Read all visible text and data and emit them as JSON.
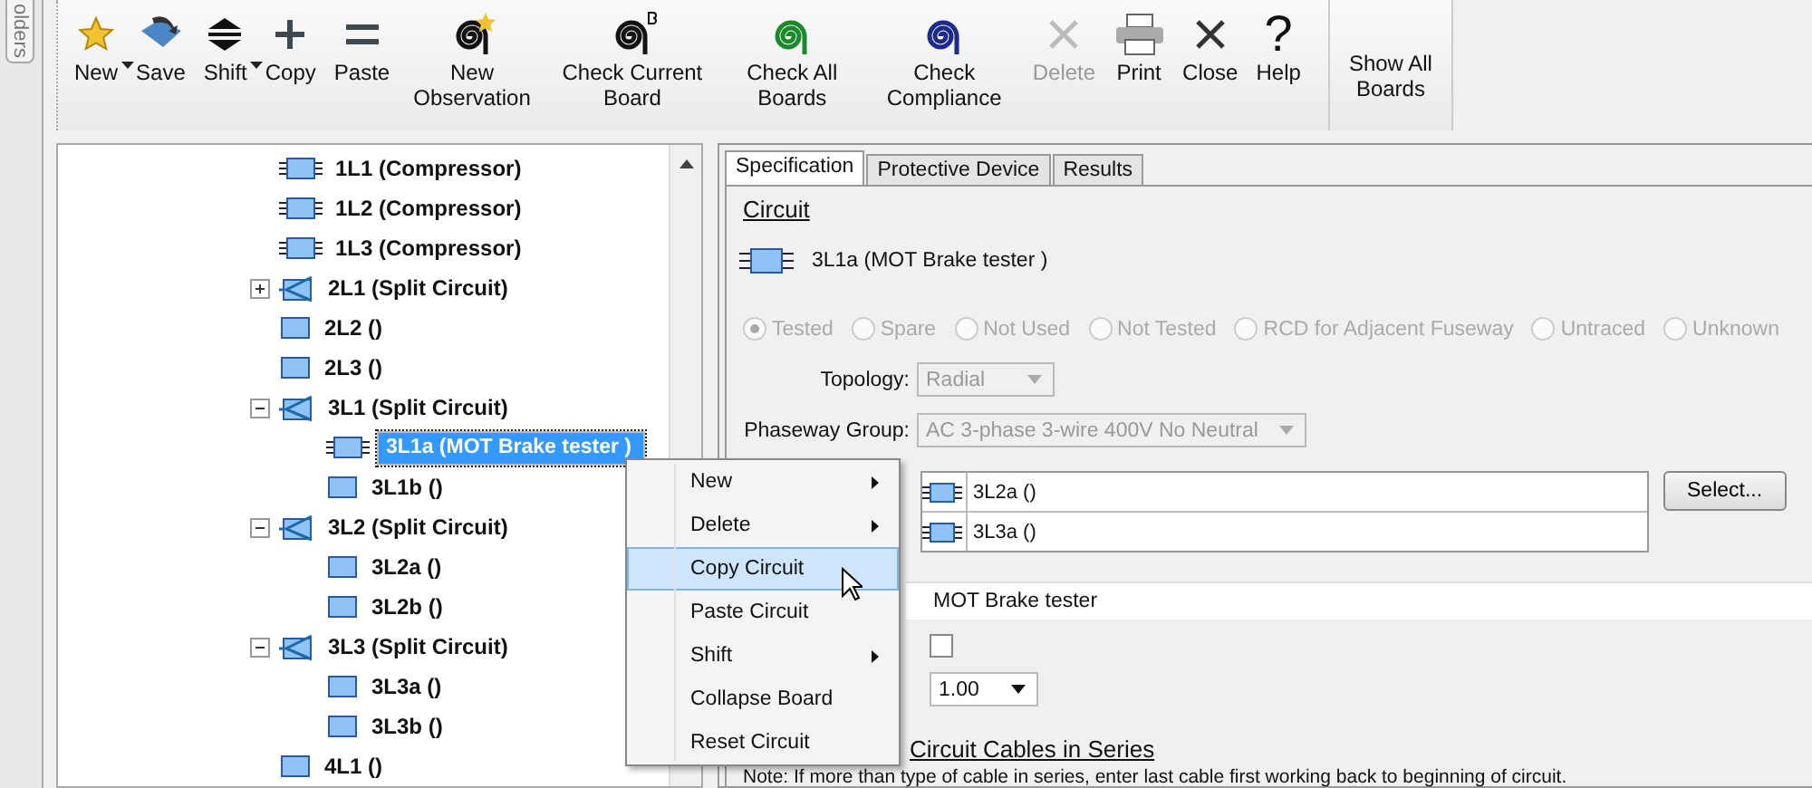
{
  "side_tab": {
    "label": "olders"
  },
  "toolbar": {
    "buttons": [
      {
        "label": "New",
        "kind": "star",
        "dropdown": true,
        "disabled": false
      },
      {
        "label": "Save",
        "kind": "save",
        "dropdown": false,
        "disabled": false
      },
      {
        "label": "Shift",
        "kind": "shift",
        "dropdown": true,
        "disabled": false
      },
      {
        "label": "Copy",
        "kind": "plus",
        "dropdown": false,
        "disabled": false
      },
      {
        "label": "Paste",
        "kind": "equals",
        "dropdown": false,
        "disabled": false
      },
      {
        "label": "New Observation",
        "kind": "spiral-star",
        "dropdown": false,
        "disabled": false
      },
      {
        "label": "Check Current Board",
        "kind": "spiral-b",
        "dropdown": false,
        "disabled": false
      },
      {
        "label": "Check All Boards",
        "kind": "spiral-green",
        "dropdown": false,
        "disabled": false
      },
      {
        "label": "Check Compliance",
        "kind": "spiral-blue",
        "dropdown": false,
        "disabled": false
      },
      {
        "label": "Delete",
        "kind": "cross",
        "dropdown": false,
        "disabled": true
      },
      {
        "label": "Print",
        "kind": "printer",
        "dropdown": false,
        "disabled": false
      },
      {
        "label": "Close",
        "kind": "cross",
        "dropdown": false,
        "disabled": false
      },
      {
        "label": "Help",
        "kind": "question",
        "glyph": "?",
        "dropdown": false,
        "disabled": false
      }
    ],
    "show_all": "Show All Boards"
  },
  "tree": {
    "items": [
      {
        "label": "1L1 (Compressor)",
        "kind": "load",
        "selected": false
      },
      {
        "label": "1L2 (Compressor)",
        "kind": "load",
        "selected": false
      },
      {
        "label": "1L3 (Compressor)",
        "kind": "load",
        "selected": false
      },
      {
        "label": "2L1 (Split Circuit)",
        "kind": "split",
        "selected": false,
        "expanded": false
      },
      {
        "label": "2L2 ()",
        "kind": "plain",
        "selected": false
      },
      {
        "label": "2L3 ()",
        "kind": "plain",
        "selected": false
      },
      {
        "label": "3L1 (Split Circuit)",
        "kind": "split",
        "selected": false,
        "expanded": true,
        "children": [
          {
            "label": "3L1a (MOT Brake tester )",
            "kind": "load",
            "selected": true
          },
          {
            "label": "3L1b ()",
            "kind": "plain",
            "selected": false
          }
        ]
      },
      {
        "label": "3L2 (Split Circuit)",
        "kind": "split",
        "selected": false,
        "expanded": true,
        "children": [
          {
            "label": "3L2a ()",
            "kind": "plain",
            "selected": false
          },
          {
            "label": "3L2b ()",
            "kind": "plain",
            "selected": false
          }
        ]
      },
      {
        "label": "3L3 (Split Circuit)",
        "kind": "split",
        "selected": false,
        "expanded": true,
        "children": [
          {
            "label": "3L3a ()",
            "kind": "plain",
            "selected": false
          },
          {
            "label": "3L3b ()",
            "kind": "plain",
            "selected": false
          }
        ]
      },
      {
        "label": "4L1 ()",
        "kind": "plain",
        "selected": false
      }
    ]
  },
  "tabs": [
    {
      "label": "Specification",
      "selected": true
    },
    {
      "label": "Protective Device",
      "selected": false
    },
    {
      "label": "Results",
      "selected": false
    }
  ],
  "circuit": {
    "heading": "Circuit",
    "name": "3L1a (MOT Brake tester )",
    "status_options": [
      {
        "label": "Tested",
        "selected": true
      },
      {
        "label": "Spare",
        "selected": false
      },
      {
        "label": "Not Used",
        "selected": false
      },
      {
        "label": "Not Tested",
        "selected": false
      },
      {
        "label": "RCD for Adjacent Fuseway",
        "selected": false
      },
      {
        "label": "Untraced",
        "selected": false
      },
      {
        "label": "Unknown",
        "selected": false
      }
    ],
    "status_disabled": true,
    "topology": {
      "label": "Topology:",
      "value": "Radial"
    },
    "phaseway": {
      "label": "Phaseway Group:",
      "value": "AC 3-phase 3-wire 400V No Neutral"
    },
    "linked": [
      "3L2a ()",
      "3L3a ()"
    ],
    "select_button": "Select...",
    "description": "MOT Brake tester",
    "checkbox": {
      "checked": false
    },
    "factor": "1.00",
    "cables_heading": "Circuit Cables in Series",
    "note": "Note: If more than type of cable in series, enter last cable first working back to beginning of circuit."
  },
  "context_menu": {
    "items": [
      {
        "label": "New",
        "submenu": true,
        "selected": false
      },
      {
        "label": "Delete",
        "submenu": true,
        "selected": false
      },
      {
        "label": "Copy Circuit",
        "submenu": false,
        "selected": true
      },
      {
        "label": "Paste Circuit",
        "submenu": false,
        "selected": false
      },
      {
        "label": "Shift",
        "submenu": true,
        "selected": false
      },
      {
        "label": "Collapse Board",
        "submenu": false,
        "selected": false
      },
      {
        "label": "Reset Circuit",
        "submenu": false,
        "selected": false
      }
    ]
  }
}
